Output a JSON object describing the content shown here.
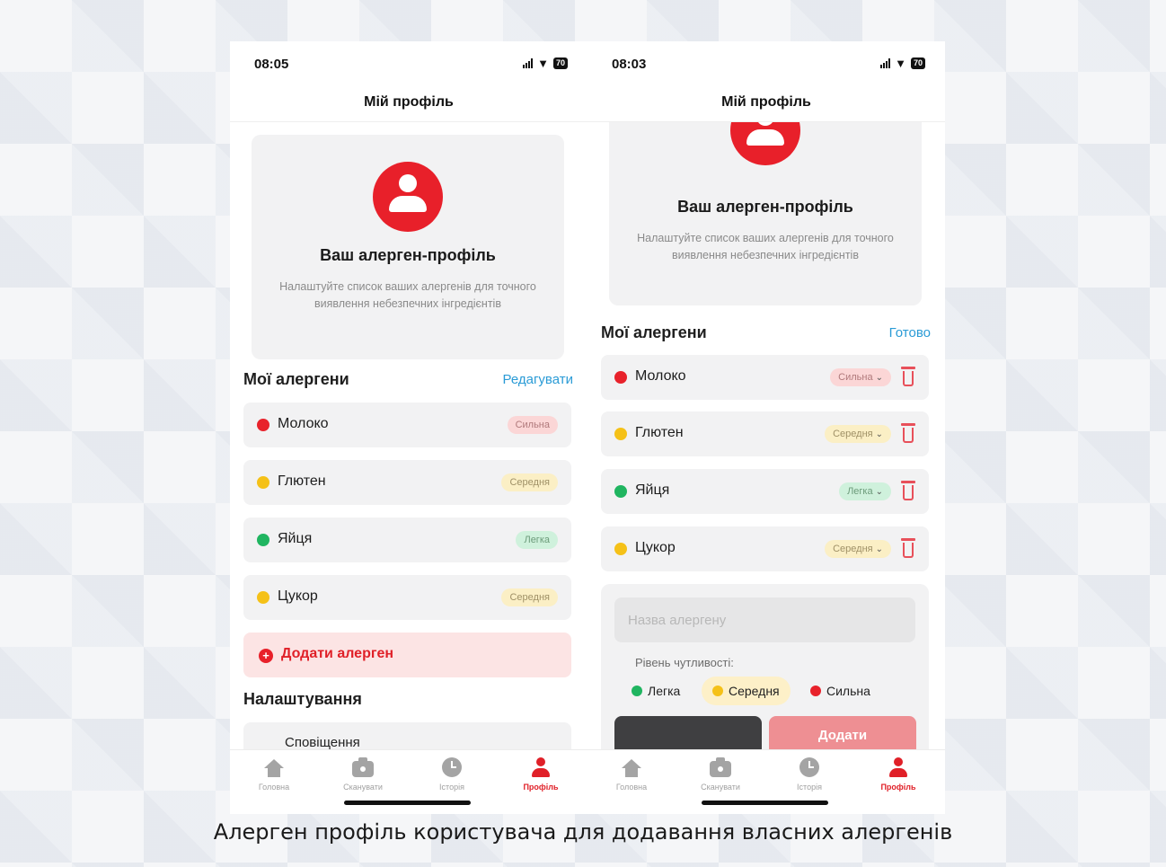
{
  "left_screen": {
    "status": {
      "time": "08:05",
      "battery": "70"
    },
    "nav_title": "Мій профіль",
    "profile_card": {
      "title": "Ваш алерген-профіль",
      "description": "Налаштуйте список ваших алергенів для точного виявлення небезпечних інгредієнтів"
    },
    "allergens_section": {
      "title": "Мої алергени",
      "action": "Редагувати"
    },
    "allergens": [
      {
        "name": "Молоко",
        "level": "Сильна",
        "color": "#e8222b"
      },
      {
        "name": "Глютен",
        "level": "Середня",
        "color": "#f5c118"
      },
      {
        "name": "Яйця",
        "level": "Легка",
        "color": "#20b560"
      },
      {
        "name": "Цукор",
        "level": "Середня",
        "color": "#f5c118"
      }
    ],
    "add_button": "Додати алерген",
    "settings_title": "Налаштування",
    "settings_first_item": "Сповіщення"
  },
  "right_screen": {
    "status": {
      "time": "08:03",
      "battery": "70"
    },
    "nav_title": "Мій профіль",
    "profile_card": {
      "title": "Ваш алерген-профіль",
      "description": "Налаштуйте список ваших алергенів для точного виявлення небезпечних інгредієнтів"
    },
    "allergens_section": {
      "title": "Мої алергени",
      "action": "Готово"
    },
    "allergens": [
      {
        "name": "Молоко",
        "level": "Сильна",
        "color": "#e8222b"
      },
      {
        "name": "Глютен",
        "level": "Середня",
        "color": "#f5c118"
      },
      {
        "name": "Яйця",
        "level": "Легка",
        "color": "#20b560"
      },
      {
        "name": "Цукор",
        "level": "Середня",
        "color": "#f5c118"
      }
    ],
    "add_form": {
      "input_placeholder": "Назва алергену",
      "sensitivity_label": "Рівень чутливості:",
      "levels": [
        "Легка",
        "Середня",
        "Сильна"
      ],
      "selected_level": "Середня",
      "submit_label": "Додати"
    }
  },
  "tab_bar": {
    "tabs": [
      {
        "label": "Головна",
        "icon": "home-icon"
      },
      {
        "label": "Сканувати",
        "icon": "camera-icon"
      },
      {
        "label": "Історія",
        "icon": "clock-icon"
      },
      {
        "label": "Профіль",
        "icon": "person-icon",
        "active": true
      }
    ],
    "accent_color": "#e02028"
  },
  "caption": "Алерген профіль користувача для додавання власних алергенів"
}
